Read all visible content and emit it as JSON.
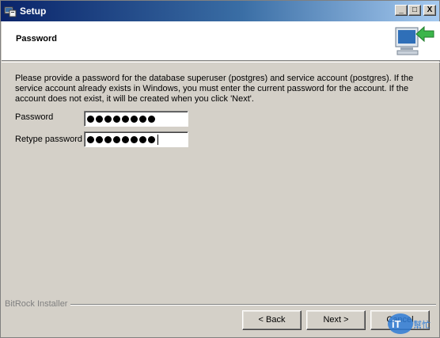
{
  "window": {
    "title": "Setup"
  },
  "titlebar_buttons": {
    "minimize": "_",
    "maximize": "□",
    "close": "X"
  },
  "header": {
    "title": "Password",
    "icon": "computer-arrow-icon"
  },
  "content": {
    "description": "Please provide a password for the database superuser (postgres) and service account (postgres). If the service account already exists in Windows, you must enter the current password for the account. If the account does not exist, it will be created when you click 'Next'.",
    "password_label": "Password",
    "password_length": 8,
    "retype_label": "Retype password",
    "retype_length": 8
  },
  "footer": {
    "brand": "BitRock Installer",
    "back_label": "< Back",
    "next_label": "Next >",
    "cancel_label": "Cancel"
  },
  "watermark": {
    "text_top": "iT邦",
    "text_side": "幫忙"
  }
}
